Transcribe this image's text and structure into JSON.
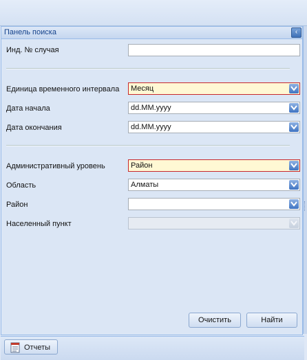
{
  "panel": {
    "title": "Панель поиска"
  },
  "form": {
    "case_id": {
      "label": "Инд. № случая",
      "value": ""
    },
    "time_unit": {
      "label": "Единица временного интервала",
      "value": "Месяц"
    },
    "start_date": {
      "label": "Дата начала",
      "value": "dd.MM.yyyy"
    },
    "end_date": {
      "label": "Дата окончания",
      "value": "dd.MM.yyyy"
    },
    "admin_level": {
      "label": "Административный уровень",
      "value": "Район"
    },
    "region": {
      "label": "Область",
      "value": "Алматы"
    },
    "district": {
      "label": "Район",
      "value": ""
    },
    "locality": {
      "label": "Населенный пункт",
      "value": ""
    }
  },
  "buttons": {
    "clear": "Очистить",
    "find": "Найти"
  },
  "footer": {
    "reports": "Отчеты"
  },
  "colors": {
    "required_bg": "#fff8d4",
    "required_border": "#c7282b",
    "header_text": "#15428b"
  }
}
